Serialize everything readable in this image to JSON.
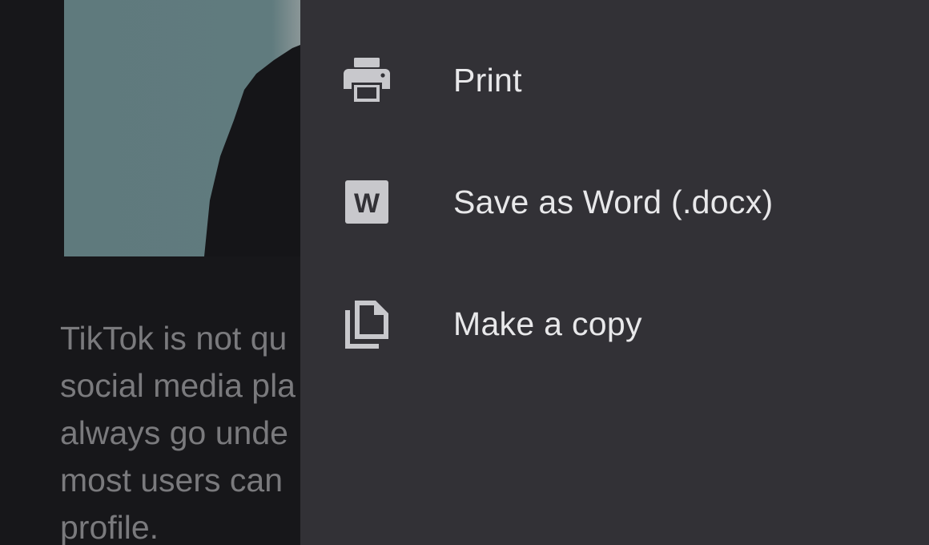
{
  "document": {
    "paragraph_lines": [
      "TikTok is not qu",
      "social media pla",
      "always go unde",
      "most users can",
      "profile."
    ]
  },
  "menu": {
    "items": [
      {
        "label": "Print",
        "icon": "printer-icon"
      },
      {
        "label": "Save as Word (.docx)",
        "icon": "word-doc-icon",
        "icon_glyph": "W"
      },
      {
        "label": "Make a copy",
        "icon": "copy-icon"
      }
    ]
  },
  "colors": {
    "menu_background": "#323136",
    "page_background": "#17171a",
    "menu_text": "#e8e8ea",
    "icon": "#c8c8cc",
    "doc_text": "#7a7a7d",
    "image_sky": "#5f7a7d"
  }
}
